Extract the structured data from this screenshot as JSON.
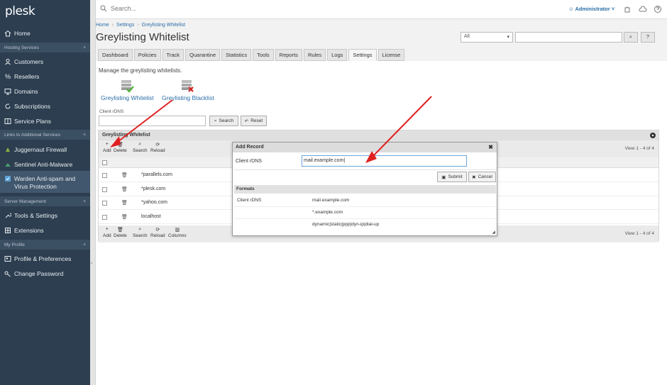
{
  "sidebar": {
    "logo": "plesk",
    "items": [
      {
        "label": "Home",
        "icon": "home-icon"
      },
      {
        "section": "Hosting Services"
      },
      {
        "label": "Customers",
        "icon": "user-icon"
      },
      {
        "label": "Resellers",
        "icon": "percent-icon"
      },
      {
        "label": "Domains",
        "icon": "monitor-icon"
      },
      {
        "label": "Subscriptions",
        "icon": "refresh-icon"
      },
      {
        "label": "Service Plans",
        "icon": "book-icon"
      },
      {
        "section": "Links to Additional Services"
      },
      {
        "label": "Juggernaut Firewall",
        "icon": "firewall-icon"
      },
      {
        "label": "Sentinel Anti-Malware",
        "icon": "sentinel-icon"
      },
      {
        "label": "Warden Anti-spam and",
        "label2": "Virus Protection",
        "icon": "warden-icon"
      },
      {
        "section": "Server Management"
      },
      {
        "label": "Tools & Settings",
        "icon": "tools-icon"
      },
      {
        "label": "Extensions",
        "icon": "extensions-icon"
      },
      {
        "section": "My Profile"
      },
      {
        "label": "Profile & Preferences",
        "icon": "profile-icon"
      },
      {
        "label": "Change Password",
        "icon": "key-icon"
      }
    ]
  },
  "topbar": {
    "search_placeholder": "Search...",
    "user": "Administrator"
  },
  "breadcrumb": [
    "Home",
    "Settings",
    "Greylisting Whitelist"
  ],
  "page_title": "Greylisting Whitelist",
  "top_filter": {
    "select_value": "All"
  },
  "tabs": [
    "Dashboard",
    "Policies",
    "Track",
    "Quarantine",
    "Statistics",
    "Tools",
    "Reports",
    "Rules",
    "Logs",
    "Settings",
    "License"
  ],
  "active_tab": "Settings",
  "description": "Manage the greylisting whitelists.",
  "links": {
    "whitelist": "Greylisting Whitelist",
    "blacklist": "Greylisting Blacklist"
  },
  "filter": {
    "label": "Client rDNS",
    "search": "Search",
    "reset": "Reset"
  },
  "grid": {
    "title": "Greylisting Whitelist",
    "toolbar": [
      "Add",
      "Delete",
      "Search",
      "Reload"
    ],
    "toolbar_bottom": [
      "Add",
      "Delete",
      "Search",
      "Reload",
      "Columns"
    ],
    "count": "View 1 - 4 of 4",
    "rows": [
      "*parallels.com",
      "*plesk.com",
      "*yahoo.com",
      "localhost"
    ]
  },
  "dialog": {
    "title": "Add Record",
    "field_label": "Client rDNS",
    "field_value": "mail.example.com",
    "submit": "Submit",
    "cancel": "Cancel",
    "formats_header": "Formats",
    "formats_label": "Client rDNS",
    "formats": [
      "mail.example.com",
      "*.example.com",
      "dynamic|static|ppp|dyn-ip|dial-up"
    ]
  },
  "colors": {
    "sidebar": "#2c3e50",
    "link": "#2a6ea7",
    "arrow": "#e02020"
  }
}
